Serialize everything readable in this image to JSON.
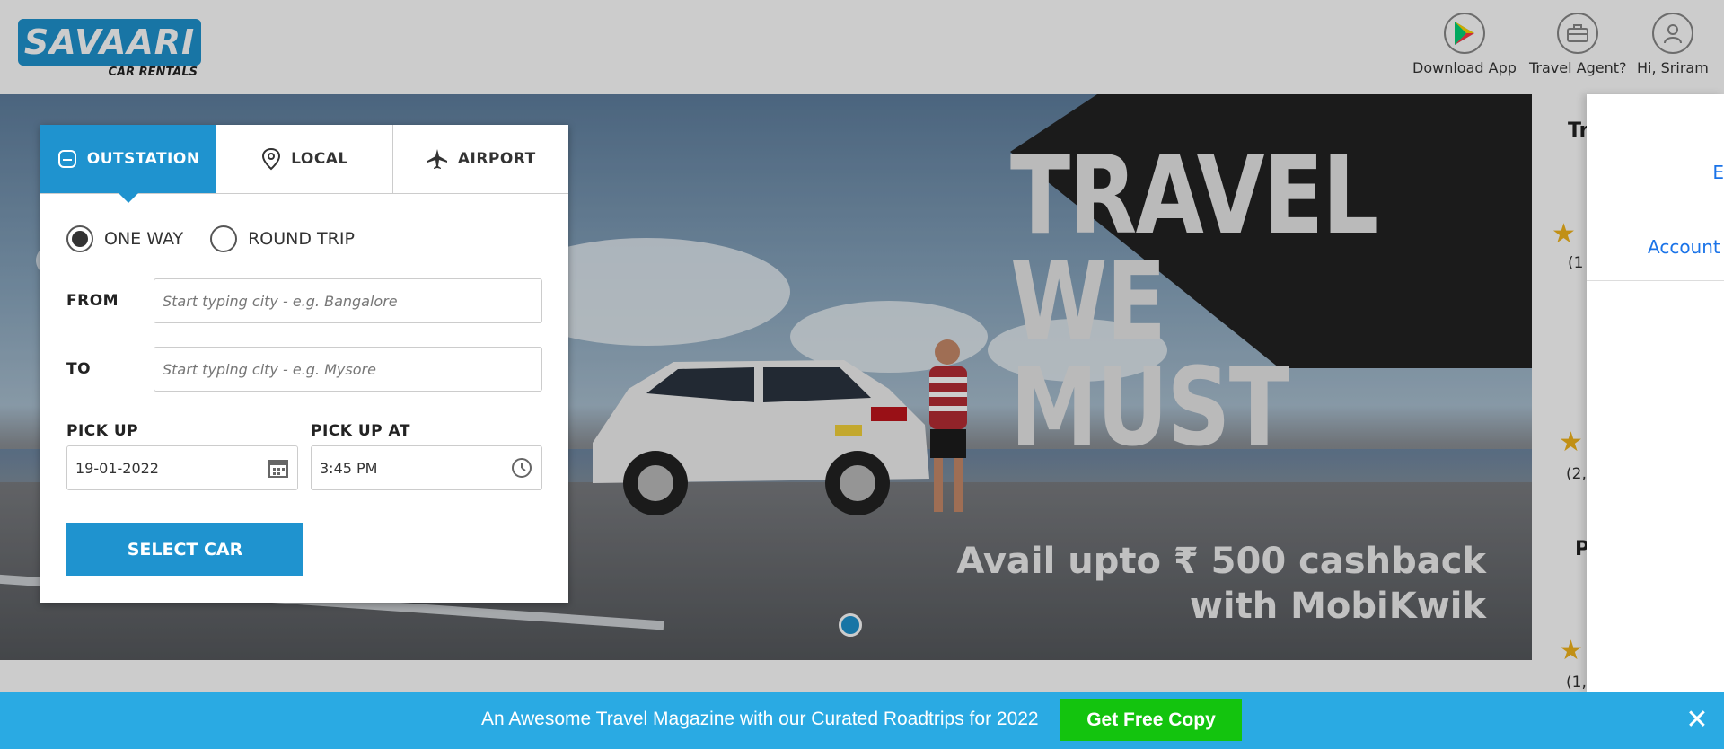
{
  "header": {
    "logo_main": "SAVAARI",
    "logo_sub": "CAR RENTALS",
    "nav": [
      {
        "label": "Download App",
        "icon": "play-store-icon"
      },
      {
        "label": "Travel Agent?",
        "icon": "briefcase-icon"
      },
      {
        "label": "Hi, Sriram",
        "icon": "user-icon"
      }
    ]
  },
  "hero": {
    "title_line1": "TRAVEL",
    "title_line2": "WE MUST",
    "cashback_line1": "Avail upto ₹ 500 cashback",
    "cashback_line2": "with MobiKwik"
  },
  "booking": {
    "tabs": [
      {
        "label": "OUTSTATION",
        "icon": "car-front-icon",
        "active": true
      },
      {
        "label": "LOCAL",
        "icon": "location-pin-icon",
        "active": false
      },
      {
        "label": "AIRPORT",
        "icon": "airplane-icon",
        "active": false
      }
    ],
    "trip_types": [
      {
        "label": "ONE WAY",
        "checked": true
      },
      {
        "label": "ROUND TRIP",
        "checked": false
      }
    ],
    "from_label": "FROM",
    "from_placeholder": "Start typing city - e.g. Bangalore",
    "to_label": "TO",
    "to_placeholder": "Start typing city - e.g. Mysore",
    "pickup_label": "PICK UP",
    "pickup_date": "19-01-2022",
    "pickup_at_label": "PICK UP AT",
    "pickup_time": "3:45 PM",
    "submit_label": "SELECT CAR"
  },
  "right_column": {
    "heading_partial": "Tr",
    "count1": "(1",
    "count2": "(2,",
    "heading2_partial": "P",
    "count3": "(1,"
  },
  "drawer": {
    "item1": "E",
    "item2": "Account"
  },
  "banner": {
    "text": "An Awesome Travel Magazine with our Curated Roadtrips for 2022",
    "button": "Get Free Copy",
    "close": "✕"
  },
  "colors": {
    "brand_blue": "#1f93cf",
    "banner_blue": "#2aaae3",
    "cta_green": "#13c40e"
  }
}
